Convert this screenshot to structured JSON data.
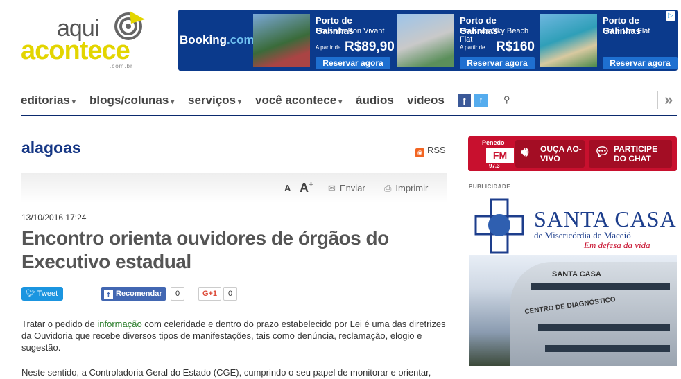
{
  "logo": {
    "line1": "aqui",
    "line2": "acontece",
    "line3": ".com.br"
  },
  "ad_banner": {
    "brand_main": "Booking",
    "brand_suffix": ".com",
    "offers": [
      {
        "place": "Porto de Galinhas",
        "hotel": "Pousada Bon Vivant",
        "from": "A partir de",
        "price": "R$89,90",
        "cta": "Reservar agora"
      },
      {
        "place": "Porto de Galinhas",
        "hotel": "Pousada Sky Beach Flat",
        "from": "A partir de",
        "price": "R$160",
        "cta": "Reservar agora"
      },
      {
        "place": "Porto de Galinhas",
        "hotel": "Sol e Mar Flat",
        "from": "",
        "price": "",
        "cta": "Reservar agora"
      }
    ]
  },
  "nav": {
    "items": [
      "editorias",
      "blogs/colunas",
      "serviços",
      "você acontece",
      "áudios",
      "vídeos"
    ],
    "search_placeholder": ""
  },
  "section": {
    "title": "alagoas",
    "rss": "RSS"
  },
  "toolbar": {
    "font_small": "A",
    "font_large": "A",
    "font_plus": "+",
    "send": "Enviar",
    "print": "Imprimir"
  },
  "article": {
    "date": "13/10/2016 17:24",
    "headline": "Encontro orienta ouvidores de órgãos do Executivo estadual",
    "tweet": "Tweet",
    "recommend": "Recomendar",
    "recommend_count": "0",
    "gplus": "G+1",
    "gplus_count": "0",
    "p1_before": "Tratar o pedido de ",
    "p1_link": "informação",
    "p1_after": " com celeridade e dentro do prazo estabelecido por Lei é uma das diretrizes da Ouvidoria que recebe diversos tipos de manifestações, tais como denúncia, reclamação, elogio e sugestão.",
    "p2": "Neste sentido, a Controladoria Geral do Estado (CGE), cumprindo o seu papel de monitorar e orientar,"
  },
  "radio": {
    "station_city": "Penedo",
    "station_band": "FM",
    "station_freq": "97.3",
    "listen": "OUÇA AO-VIVO",
    "chat": "PARTICIPE DO CHAT"
  },
  "sidebar_ad": {
    "label": "PUBLICIDADE",
    "name": "SANTA CASA",
    "subtitle": "de Misericórdia de Maceió",
    "slogan": "Em defesa da vida",
    "facade_sign": "SANTA CASA",
    "facade_sign2": "CENTRO DE DIAGNÓSTICO"
  }
}
